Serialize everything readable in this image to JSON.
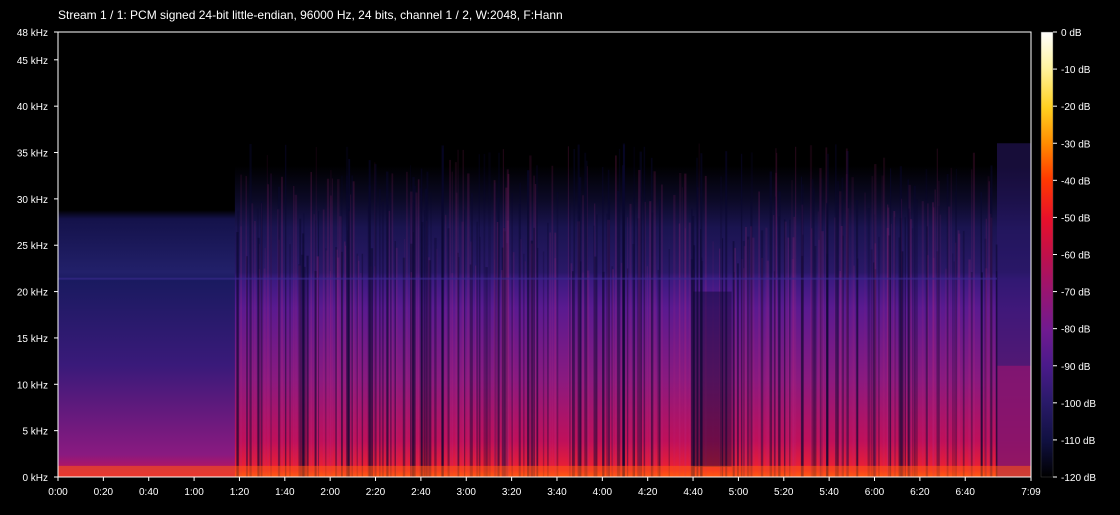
{
  "chart_data": {
    "type": "heatmap",
    "title": "Stream 1 / 1: PCM signed 24-bit little-endian, 96000 Hz, 24 bits, channel 1 / 2, W:2048, F:Hann",
    "x_ticks": [
      "0:00",
      "0:20",
      "0:40",
      "1:00",
      "1:20",
      "1:40",
      "2:00",
      "2:20",
      "2:40",
      "3:00",
      "3:20",
      "3:40",
      "4:00",
      "4:20",
      "4:40",
      "5:00",
      "5:20",
      "5:40",
      "6:00",
      "6:20",
      "6:40",
      "7:09"
    ],
    "x_tick_seconds": [
      0,
      20,
      40,
      60,
      80,
      100,
      120,
      140,
      160,
      180,
      200,
      220,
      240,
      260,
      280,
      300,
      320,
      340,
      360,
      380,
      400,
      429
    ],
    "x_range_seconds": [
      0,
      429
    ],
    "y_ticks_khz": [
      0,
      5,
      10,
      15,
      20,
      25,
      30,
      35,
      40,
      45,
      48
    ],
    "y_tick_labels": [
      "0 kHz",
      "5 kHz",
      "10 kHz",
      "15 kHz",
      "20 kHz",
      "25 kHz",
      "30 kHz",
      "35 kHz",
      "40 kHz",
      "45 kHz",
      "48 kHz"
    ],
    "y_range_khz": [
      0,
      48
    ],
    "colorbar": {
      "labels": [
        "0 dB",
        "-10 dB",
        "-20 dB",
        "-30 dB",
        "-40 dB",
        "-50 dB",
        "-60 dB",
        "-70 dB",
        "-80 dB",
        "-90 dB",
        "-100 dB",
        "-110 dB",
        "-120 dB"
      ],
      "range_db": [
        0,
        -120
      ],
      "colors": [
        "#ffffff",
        "#fff4a0",
        "#ffd020",
        "#ff8c00",
        "#ff3a00",
        "#e8102a",
        "#c0104a",
        "#9a1470",
        "#701a90",
        "#4a1a8a",
        "#2a1a6a",
        "#101040",
        "#000000"
      ]
    },
    "grid": false
  }
}
